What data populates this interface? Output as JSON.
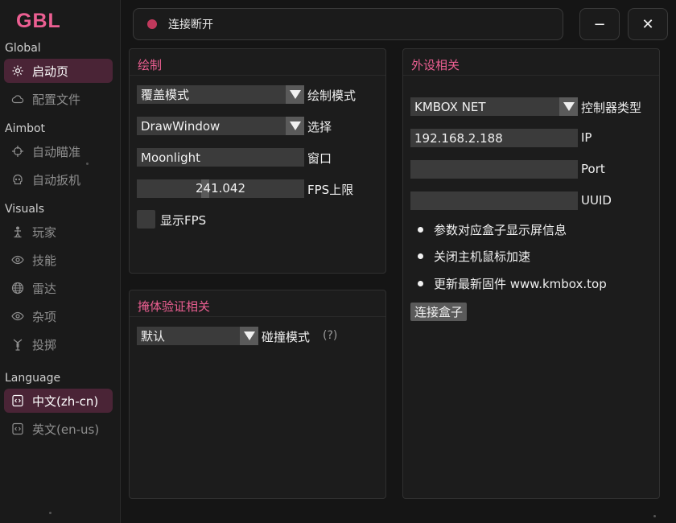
{
  "app": {
    "logo": "GBL"
  },
  "sidebar": {
    "sections": {
      "global": "Global",
      "aimbot": "Aimbot",
      "visuals": "Visuals",
      "language": "Language"
    },
    "items": [
      {
        "label": "启动页",
        "icon": "gear-icon"
      },
      {
        "label": "配置文件",
        "icon": "cloud-icon"
      },
      {
        "label": "自动瞄准",
        "icon": "crosshair-icon"
      },
      {
        "label": "自动扳机",
        "icon": "skull-icon"
      },
      {
        "label": "玩家",
        "icon": "person-icon"
      },
      {
        "label": "技能",
        "icon": "eye-icon"
      },
      {
        "label": "雷达",
        "icon": "globe-icon"
      },
      {
        "label": "杂项",
        "icon": "eye-icon"
      },
      {
        "label": "投掷",
        "icon": "grenade-icon"
      },
      {
        "label": "中文(zh-cn)",
        "icon": "code-file-icon"
      },
      {
        "label": "英文(en-us)",
        "icon": "code-file-icon"
      }
    ]
  },
  "topbar": {
    "status_text": "连接断开",
    "status_color": "#c0395c",
    "minimize_label": "−",
    "close_label": "✕"
  },
  "draw_panel": {
    "title": "绘制",
    "mode_value": "覆盖模式",
    "mode_label": "绘制模式",
    "select_value": "DrawWindow",
    "select_label": "选择",
    "window_value": "Moonlight",
    "window_label": "窗口",
    "fps_value": "241.042",
    "fps_label": "FPS上限",
    "show_fps_label": "显示FPS"
  },
  "cover_panel": {
    "title": "掩体验证相关",
    "mode_value": "默认",
    "mode_label": "碰撞模式",
    "help": "(?)"
  },
  "device_panel": {
    "title": "外设相关",
    "controller_value": "KMBOX NET",
    "controller_label": "控制器类型",
    "ip_value": "192.168.2.188",
    "ip_label": "IP",
    "port_value": "",
    "port_label": "Port",
    "uuid_value": "",
    "uuid_label": "UUID",
    "notes": [
      "参数对应盒子显示屏信息",
      "关闭主机鼠标加速",
      "更新最新固件 www.kmbox.top"
    ],
    "connect_button": "连接盒子"
  },
  "colors": {
    "accent": "#ec5f92",
    "active_bg": "#4a2436"
  }
}
